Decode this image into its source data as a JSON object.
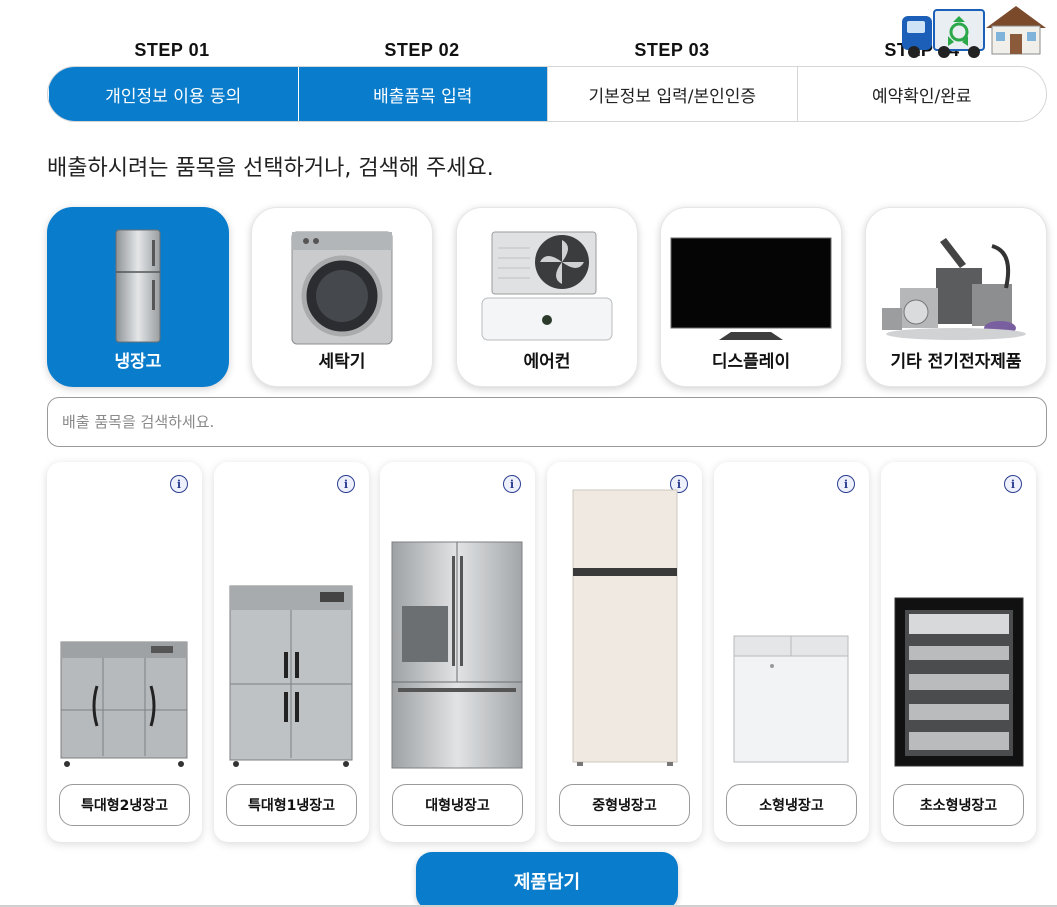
{
  "steps": [
    {
      "label": "STEP 01",
      "title": "개인정보 이용 동의",
      "active": true
    },
    {
      "label": "STEP 02",
      "title": "배출품목 입력",
      "active": true
    },
    {
      "label": "STEP 03",
      "title": "기본정보 입력/본인인증",
      "active": false
    },
    {
      "label": "STEP 04",
      "title": "예약확인/완료",
      "active": false
    }
  ],
  "header": {
    "logo_icon": "recycling-truck-house-icon"
  },
  "instruction": "배출하시려는 품목을 선택하거나, 검색해 주세요.",
  "categories": [
    {
      "label": "냉장고",
      "icon": "refrigerator-icon",
      "selected": true
    },
    {
      "label": "세탁기",
      "icon": "washing-machine-icon",
      "selected": false
    },
    {
      "label": "에어컨",
      "icon": "air-conditioner-icon",
      "selected": false
    },
    {
      "label": "디스플레이",
      "icon": "display-icon",
      "selected": false
    },
    {
      "label": "기타 전기전자제품",
      "icon": "appliances-icon",
      "selected": false
    }
  ],
  "search": {
    "placeholder": "배출 품목을 검색하세요.",
    "value": ""
  },
  "products": [
    {
      "label": "특대형2냉장고",
      "icon": "commercial-fridge-6door-icon"
    },
    {
      "label": "특대형1냉장고",
      "icon": "commercial-fridge-4door-icon"
    },
    {
      "label": "대형냉장고",
      "icon": "french-door-fridge-icon"
    },
    {
      "label": "중형냉장고",
      "icon": "two-door-fridge-icon"
    },
    {
      "label": "소형냉장고",
      "icon": "chest-freezer-icon"
    },
    {
      "label": "초소형냉장고",
      "icon": "mini-fridge-icon"
    }
  ],
  "info_glyph": "i",
  "add_button": "제품담기",
  "colors": {
    "accent": "#0a7ccc",
    "border": "#d6d6d6"
  }
}
